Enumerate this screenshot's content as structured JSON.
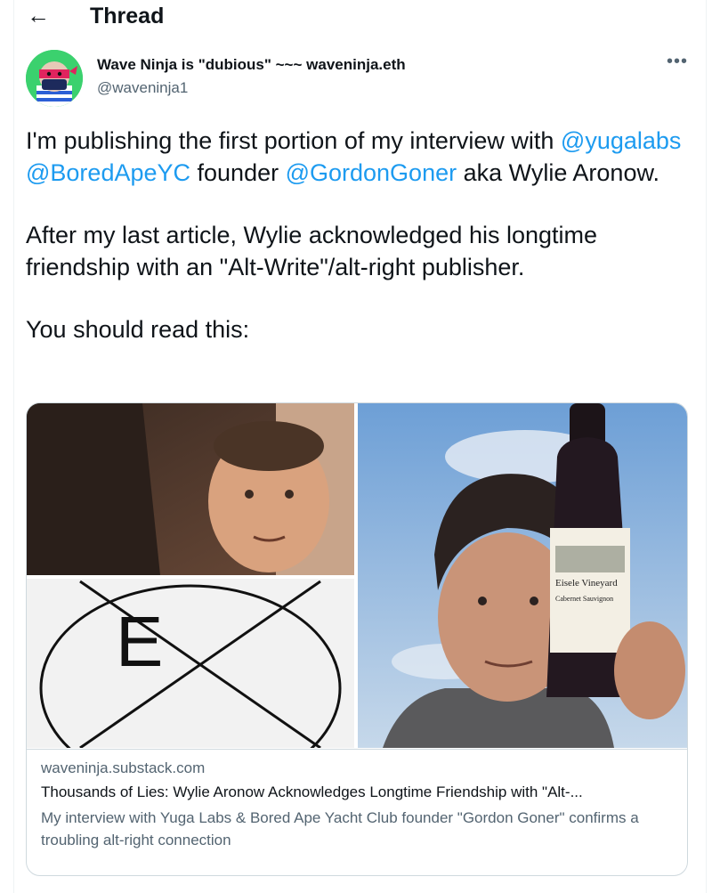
{
  "header": {
    "back_icon": "arrow-left-icon",
    "title": "Thread"
  },
  "author": {
    "display_name": "Wave Ninja is \"dubious\" ~~~ waveninja.eth",
    "handle": "@waveninja1",
    "more_icon": "more-horizontal-icon",
    "more_glyph": "•••"
  },
  "tweet": {
    "p1_text1": "I'm publishing the first portion of my interview with ",
    "p1_m1": "@yugalabs",
    "p1_sp1": " ",
    "p1_m2": "@BoredApeYC",
    "p1_text2": " founder ",
    "p1_m3": "@GordonGoner",
    "p1_text3": " aka Wylie Aronow.",
    "p2": "After my last article, Wylie acknowledged his longtime friendship with an \"Alt-Write\"/alt-right publisher.",
    "p3": "You should read this:"
  },
  "card": {
    "logo_letter": "E",
    "wine_label_vineyard": "Eisele Vineyard",
    "wine_label_wine": "Cabernet Sauvignon",
    "domain": "waveninja.substack.com",
    "title": "Thousands of Lies: Wylie Aronow Acknowledges Longtime Friendship with \"Alt-...",
    "description": "My interview with Yuga Labs & Bored Ape Yacht Club founder \"Gordon Goner\" confirms a troubling alt-right connection"
  }
}
